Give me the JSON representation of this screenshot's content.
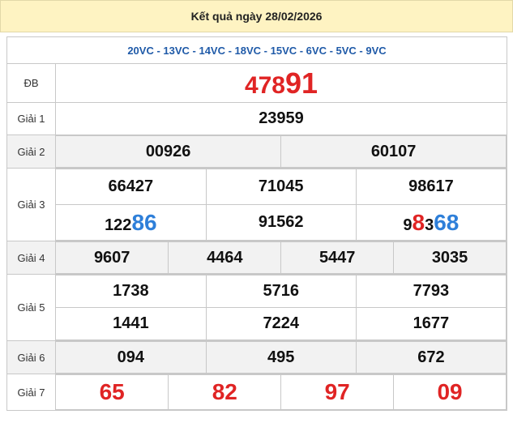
{
  "header": {
    "title": "Kết quả ngày 28/02/2026"
  },
  "codes": "20VC - 13VC - 14VC - 18VC - 15VC - 6VC - 5VC - 9VC",
  "db": {
    "label": "ĐB",
    "prefix": "478",
    "suffix": "91"
  },
  "g1": {
    "label": "Giải 1",
    "values": [
      "23959"
    ]
  },
  "g2": {
    "label": "Giải 2",
    "values": [
      "00926",
      "60107"
    ]
  },
  "g3": {
    "label": "Giải 3",
    "row1": [
      "66427",
      "71045",
      "98617"
    ],
    "r2a": {
      "plain": "122",
      "blue": "86"
    },
    "r2b": "91562",
    "r2c": {
      "plain": "9",
      "red": "8",
      "plain2": "3",
      "blue": "68"
    }
  },
  "g4": {
    "label": "Giải 4",
    "values": [
      "9607",
      "4464",
      "5447",
      "3035"
    ]
  },
  "g5": {
    "label": "Giải 5",
    "row1": [
      "1738",
      "5716",
      "7793"
    ],
    "row2": [
      "1441",
      "7224",
      "1677"
    ]
  },
  "g6": {
    "label": "Giải 6",
    "values": [
      "094",
      "495",
      "672"
    ]
  },
  "g7": {
    "label": "Giải 7",
    "values": [
      "65",
      "82",
      "97",
      "09"
    ]
  },
  "colors": {
    "red": "#e02424",
    "blue": "#2e7fd9",
    "header_bg": "#fef3c2",
    "codes_blue": "#1f5aa8"
  }
}
